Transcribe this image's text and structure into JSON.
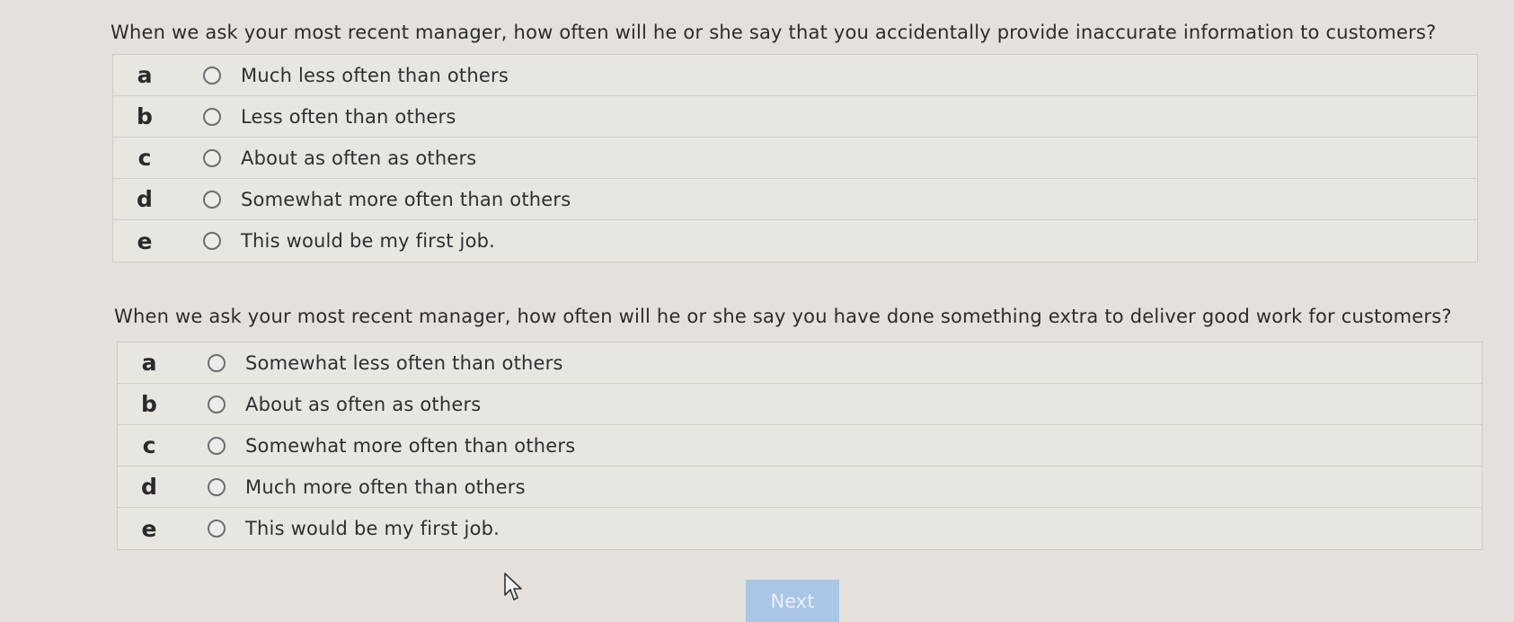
{
  "question1": {
    "text": "When we ask your most recent manager, how often will he or she say that you accidentally provide inaccurate information to customers?",
    "options": [
      {
        "letter": "a",
        "label": "Much less often than others"
      },
      {
        "letter": "b",
        "label": "Less often than others"
      },
      {
        "letter": "c",
        "label": "About as often as others"
      },
      {
        "letter": "d",
        "label": "Somewhat more often than others"
      },
      {
        "letter": "e",
        "label": "This would be my first job."
      }
    ]
  },
  "question2": {
    "text": "When we ask your most recent manager, how often will he or she say you have done something extra to deliver good work for customers?",
    "options": [
      {
        "letter": "a",
        "label": "Somewhat less often than others"
      },
      {
        "letter": "b",
        "label": "About as often as others"
      },
      {
        "letter": "c",
        "label": "Somewhat more often than others"
      },
      {
        "letter": "d",
        "label": "Much more often than others"
      },
      {
        "letter": "e",
        "label": "This would be my first job."
      }
    ]
  },
  "next_button": {
    "label": "Next",
    "color": "#a9c6e6"
  },
  "cursor": {
    "icon": "mouse-pointer-icon"
  }
}
